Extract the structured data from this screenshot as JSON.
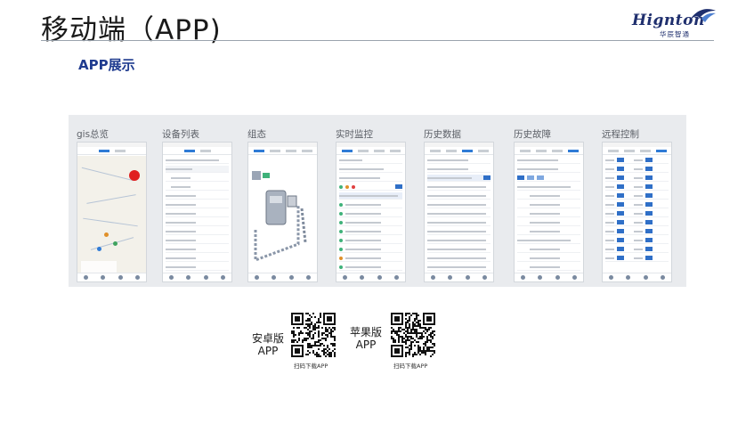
{
  "header": {
    "title": "移动端（APP)",
    "logo_text": "Hignton",
    "logo_cn": "华辰智通",
    "brand_color": "#1f2f6e"
  },
  "section": {
    "subtitle": "APP展示",
    "accent_color": "#1f3b8f"
  },
  "screens": [
    {
      "title": "gis总览"
    },
    {
      "title": "设备列表"
    },
    {
      "title": "组态"
    },
    {
      "title": "实时监控"
    },
    {
      "title": "历史数据"
    },
    {
      "title": "历史故障"
    },
    {
      "title": "远程控制"
    }
  ],
  "downloads": {
    "android": {
      "label_line1": "安卓版",
      "label_line2": "APP",
      "caption": "扫码下载APP",
      "icon": "qr-code-icon"
    },
    "ios": {
      "label_line1": "苹果版",
      "label_line2": "APP",
      "caption": "扫码下载APP",
      "icon": "qr-code-icon"
    }
  }
}
